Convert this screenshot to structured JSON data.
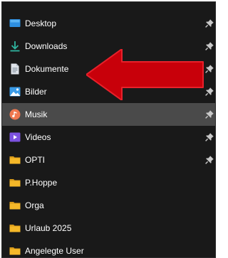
{
  "navigation": {
    "items": [
      {
        "label": "Desktop",
        "icon": "desktop-icon",
        "pinned": true,
        "selected": false
      },
      {
        "label": "Downloads",
        "icon": "download-icon",
        "pinned": true,
        "selected": false
      },
      {
        "label": "Dokumente",
        "icon": "document-icon",
        "pinned": true,
        "selected": false
      },
      {
        "label": "Bilder",
        "icon": "pictures-icon",
        "pinned": true,
        "selected": false
      },
      {
        "label": "Musik",
        "icon": "music-icon",
        "pinned": true,
        "selected": true
      },
      {
        "label": "Videos",
        "icon": "videos-icon",
        "pinned": true,
        "selected": false
      },
      {
        "label": "OPTI",
        "icon": "folder-icon",
        "pinned": true,
        "selected": false
      },
      {
        "label": "P.Hoppe",
        "icon": "folder-icon",
        "pinned": false,
        "selected": false
      },
      {
        "label": "Orga",
        "icon": "folder-icon",
        "pinned": false,
        "selected": false
      },
      {
        "label": "Urlaub 2025",
        "icon": "folder-icon",
        "pinned": false,
        "selected": false
      },
      {
        "label": "Angelegte User",
        "icon": "folder-icon",
        "pinned": false,
        "selected": false
      }
    ]
  },
  "colors": {
    "background": "#191919",
    "selection": "#4a4a4a",
    "text": "#ffffff",
    "pin": "#c8c8c8",
    "annotation_arrow": "#c8000a",
    "folder": "#f5b829"
  }
}
